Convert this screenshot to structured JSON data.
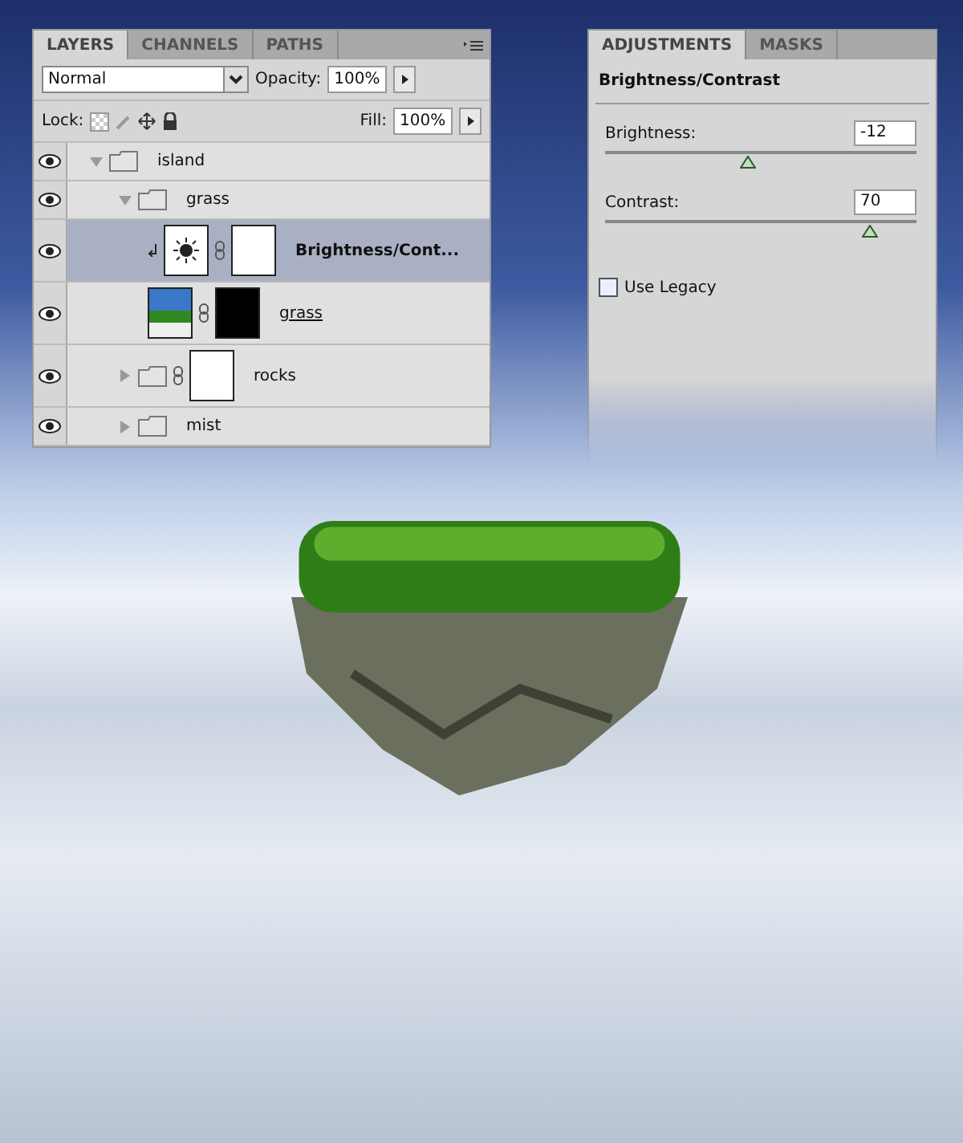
{
  "layers_panel": {
    "tabs": [
      {
        "label": "LAYERS",
        "selected": true
      },
      {
        "label": "CHANNELS",
        "selected": false
      },
      {
        "label": "PATHS",
        "selected": false
      }
    ],
    "blend_mode": "Normal",
    "opacity_label": "Opacity:",
    "opacity": "100%",
    "lock_label": "Lock:",
    "fill_label": "Fill:",
    "fill": "100%",
    "layers": [
      {
        "name": "island",
        "kind": "group",
        "visible": true,
        "expanded": true,
        "selected": false,
        "children": [
          {
            "name": "grass",
            "kind": "group",
            "visible": true,
            "expanded": true,
            "selected": false,
            "children": [
              {
                "name": "Brightness/Cont...",
                "kind": "adjustment",
                "visible": true,
                "selected": true
              },
              {
                "name": "grass",
                "kind": "smart",
                "visible": true,
                "selected": false
              }
            ]
          },
          {
            "name": "rocks",
            "kind": "masked-group",
            "visible": true,
            "expanded": false,
            "selected": false
          },
          {
            "name": "mist",
            "kind": "group",
            "visible": true,
            "expanded": false,
            "selected": false
          }
        ]
      }
    ]
  },
  "adjustments_panel": {
    "tabs": [
      {
        "label": "ADJUSTMENTS",
        "selected": true
      },
      {
        "label": "MASKS",
        "selected": false
      }
    ],
    "title": "Brightness/Contrast",
    "sliders": [
      {
        "label": "Brightness:",
        "value": "-12",
        "level": 0.46
      },
      {
        "label": "Contrast:",
        "value": "70",
        "level": 0.85
      }
    ],
    "use_legacy": {
      "label": "Use Legacy",
      "checked": false
    }
  }
}
